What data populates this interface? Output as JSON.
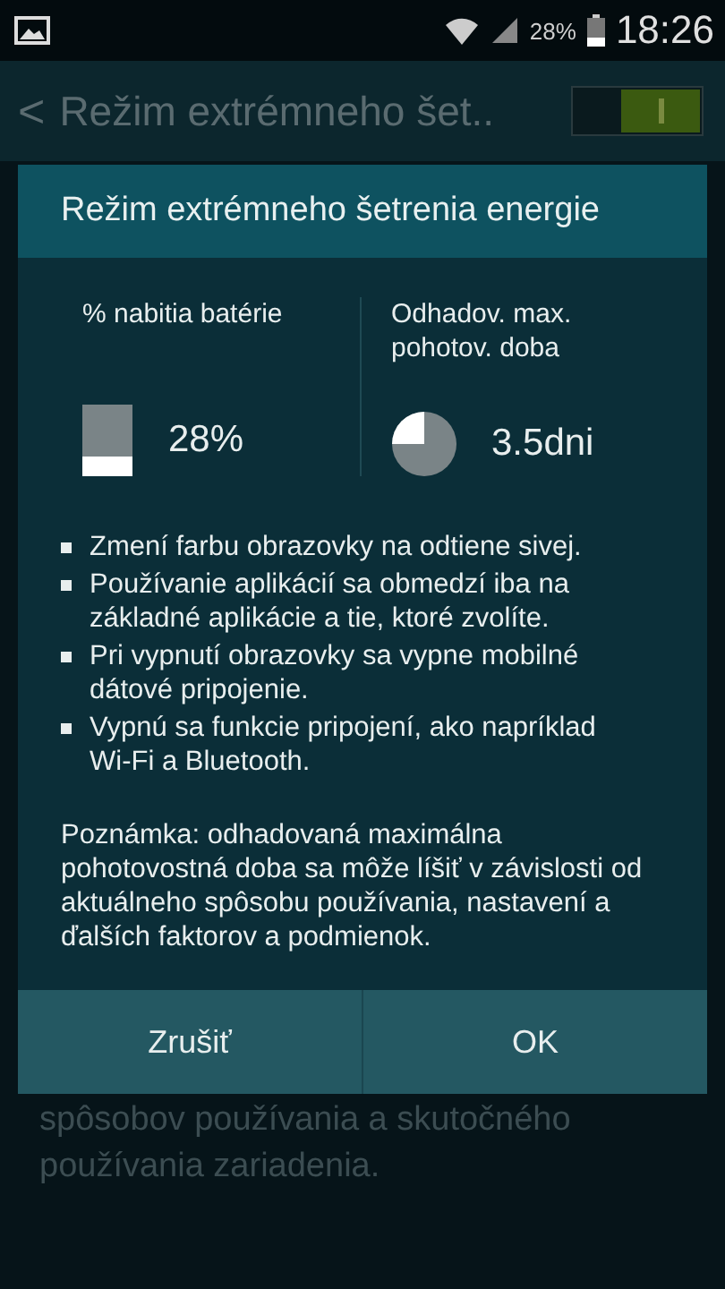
{
  "status_bar": {
    "battery_text": "28%",
    "time": "18:26"
  },
  "app_bar": {
    "back": "<",
    "title": "Režim extrémneho šet..",
    "switch": {
      "on": true
    }
  },
  "dialog": {
    "title": "Režim extrémneho šetrenia energie",
    "stats": [
      {
        "kind": "battery",
        "label": "% nabitia batérie",
        "value": "28%",
        "level": 0.28
      },
      {
        "kind": "pie",
        "label": "Odhadov. max. pohotov. doba",
        "value": "3.5dni"
      }
    ],
    "bullets": [
      "Zmení farbu obrazovky na odtiene sivej.",
      "Používanie aplikácií sa obmedzí iba na základné aplikácie a tie, ktoré zvolíte.",
      "Pri vypnutí obrazovky sa vypne mobilné dátové pripojenie.",
      "Vypnú sa funkcie pripojení, ako napríklad Wi-Fi a Bluetooth."
    ],
    "note": "Poznámka: odhadovaná maximálna pohotovostná doba sa môže líšiť v závislosti od aktuálneho spôsobu používania, nastavení a ďalších faktorov a podmienok.",
    "buttons": [
      "Zrušiť",
      "OK"
    ]
  },
  "background_text": [
    "spôsobov používania a skutočného",
    "používania zariadenia."
  ]
}
